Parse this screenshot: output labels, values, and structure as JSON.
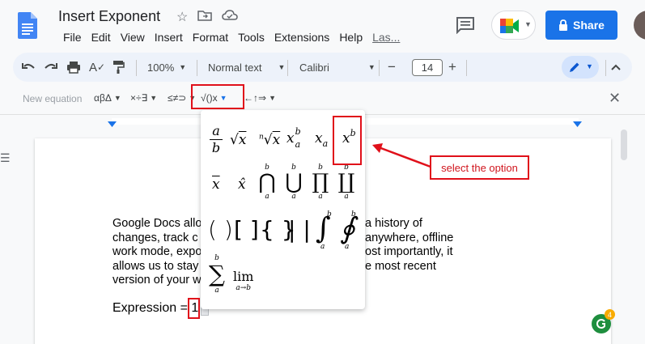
{
  "doc": {
    "title": "Insert Exponent",
    "menu": [
      "File",
      "Edit",
      "View",
      "Insert",
      "Format",
      "Tools",
      "Extensions",
      "Help"
    ],
    "last_edit": "Las..."
  },
  "header": {
    "share_label": "Share"
  },
  "toolbar": {
    "zoom": "100%",
    "style": "Normal text",
    "font": "Calibri",
    "minus": "−",
    "font_size": "14",
    "plus": "+"
  },
  "equation_bar": {
    "new_equation": "New equation",
    "groups": [
      "αβΔ",
      "×÷∃",
      "≤≠⊃",
      "√()x",
      "←↑⇒"
    ]
  },
  "dropdown": {
    "symbols": [
      "a/b",
      "√x",
      "ⁿ√x",
      "x_a^b",
      "x_a",
      "x^b",
      "x̄",
      "x̂",
      "⋂",
      "⋃",
      "∏",
      "∐",
      "()",
      "[]",
      "{}",
      "||",
      "∫",
      "∮",
      "∑",
      "lim"
    ]
  },
  "document": {
    "body_lines": [
      "Google Docs allo",
      "changes, track c",
      "work mode, expo",
      "allows us to stay",
      "version of your w"
    ],
    "body_lines_right": [
      "a history of",
      "anywhere, offline",
      "ost importantly, it",
      "e most recent",
      ""
    ],
    "expression_label": "Expression = ",
    "expression_value": "1"
  },
  "annotation": {
    "callout": "select the option"
  },
  "badge": {
    "count": "4"
  },
  "colors": {
    "accent": "#1a73e8",
    "annotation": "#e0101a"
  }
}
